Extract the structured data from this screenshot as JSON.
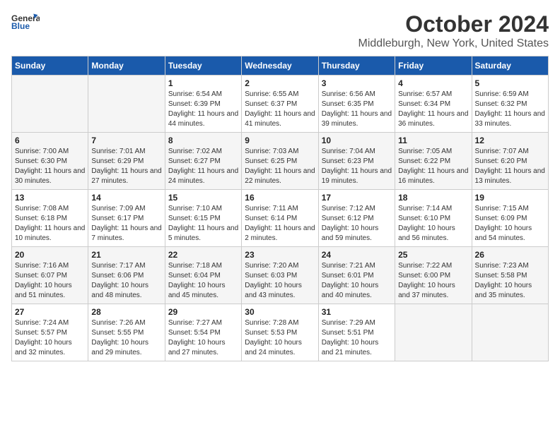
{
  "header": {
    "logo_general": "General",
    "logo_blue": "Blue",
    "title": "October 2024",
    "subtitle": "Middleburgh, New York, United States"
  },
  "weekdays": [
    "Sunday",
    "Monday",
    "Tuesday",
    "Wednesday",
    "Thursday",
    "Friday",
    "Saturday"
  ],
  "weeks": [
    [
      {
        "day": "",
        "info": ""
      },
      {
        "day": "",
        "info": ""
      },
      {
        "day": "1",
        "info": "Sunrise: 6:54 AM\nSunset: 6:39 PM\nDaylight: 11 hours and 44 minutes."
      },
      {
        "day": "2",
        "info": "Sunrise: 6:55 AM\nSunset: 6:37 PM\nDaylight: 11 hours and 41 minutes."
      },
      {
        "day": "3",
        "info": "Sunrise: 6:56 AM\nSunset: 6:35 PM\nDaylight: 11 hours and 39 minutes."
      },
      {
        "day": "4",
        "info": "Sunrise: 6:57 AM\nSunset: 6:34 PM\nDaylight: 11 hours and 36 minutes."
      },
      {
        "day": "5",
        "info": "Sunrise: 6:59 AM\nSunset: 6:32 PM\nDaylight: 11 hours and 33 minutes."
      }
    ],
    [
      {
        "day": "6",
        "info": "Sunrise: 7:00 AM\nSunset: 6:30 PM\nDaylight: 11 hours and 30 minutes."
      },
      {
        "day": "7",
        "info": "Sunrise: 7:01 AM\nSunset: 6:29 PM\nDaylight: 11 hours and 27 minutes."
      },
      {
        "day": "8",
        "info": "Sunrise: 7:02 AM\nSunset: 6:27 PM\nDaylight: 11 hours and 24 minutes."
      },
      {
        "day": "9",
        "info": "Sunrise: 7:03 AM\nSunset: 6:25 PM\nDaylight: 11 hours and 22 minutes."
      },
      {
        "day": "10",
        "info": "Sunrise: 7:04 AM\nSunset: 6:23 PM\nDaylight: 11 hours and 19 minutes."
      },
      {
        "day": "11",
        "info": "Sunrise: 7:05 AM\nSunset: 6:22 PM\nDaylight: 11 hours and 16 minutes."
      },
      {
        "day": "12",
        "info": "Sunrise: 7:07 AM\nSunset: 6:20 PM\nDaylight: 11 hours and 13 minutes."
      }
    ],
    [
      {
        "day": "13",
        "info": "Sunrise: 7:08 AM\nSunset: 6:18 PM\nDaylight: 11 hours and 10 minutes."
      },
      {
        "day": "14",
        "info": "Sunrise: 7:09 AM\nSunset: 6:17 PM\nDaylight: 11 hours and 7 minutes."
      },
      {
        "day": "15",
        "info": "Sunrise: 7:10 AM\nSunset: 6:15 PM\nDaylight: 11 hours and 5 minutes."
      },
      {
        "day": "16",
        "info": "Sunrise: 7:11 AM\nSunset: 6:14 PM\nDaylight: 11 hours and 2 minutes."
      },
      {
        "day": "17",
        "info": "Sunrise: 7:12 AM\nSunset: 6:12 PM\nDaylight: 10 hours and 59 minutes."
      },
      {
        "day": "18",
        "info": "Sunrise: 7:14 AM\nSunset: 6:10 PM\nDaylight: 10 hours and 56 minutes."
      },
      {
        "day": "19",
        "info": "Sunrise: 7:15 AM\nSunset: 6:09 PM\nDaylight: 10 hours and 54 minutes."
      }
    ],
    [
      {
        "day": "20",
        "info": "Sunrise: 7:16 AM\nSunset: 6:07 PM\nDaylight: 10 hours and 51 minutes."
      },
      {
        "day": "21",
        "info": "Sunrise: 7:17 AM\nSunset: 6:06 PM\nDaylight: 10 hours and 48 minutes."
      },
      {
        "day": "22",
        "info": "Sunrise: 7:18 AM\nSunset: 6:04 PM\nDaylight: 10 hours and 45 minutes."
      },
      {
        "day": "23",
        "info": "Sunrise: 7:20 AM\nSunset: 6:03 PM\nDaylight: 10 hours and 43 minutes."
      },
      {
        "day": "24",
        "info": "Sunrise: 7:21 AM\nSunset: 6:01 PM\nDaylight: 10 hours and 40 minutes."
      },
      {
        "day": "25",
        "info": "Sunrise: 7:22 AM\nSunset: 6:00 PM\nDaylight: 10 hours and 37 minutes."
      },
      {
        "day": "26",
        "info": "Sunrise: 7:23 AM\nSunset: 5:58 PM\nDaylight: 10 hours and 35 minutes."
      }
    ],
    [
      {
        "day": "27",
        "info": "Sunrise: 7:24 AM\nSunset: 5:57 PM\nDaylight: 10 hours and 32 minutes."
      },
      {
        "day": "28",
        "info": "Sunrise: 7:26 AM\nSunset: 5:55 PM\nDaylight: 10 hours and 29 minutes."
      },
      {
        "day": "29",
        "info": "Sunrise: 7:27 AM\nSunset: 5:54 PM\nDaylight: 10 hours and 27 minutes."
      },
      {
        "day": "30",
        "info": "Sunrise: 7:28 AM\nSunset: 5:53 PM\nDaylight: 10 hours and 24 minutes."
      },
      {
        "day": "31",
        "info": "Sunrise: 7:29 AM\nSunset: 5:51 PM\nDaylight: 10 hours and 21 minutes."
      },
      {
        "day": "",
        "info": ""
      },
      {
        "day": "",
        "info": ""
      }
    ]
  ]
}
